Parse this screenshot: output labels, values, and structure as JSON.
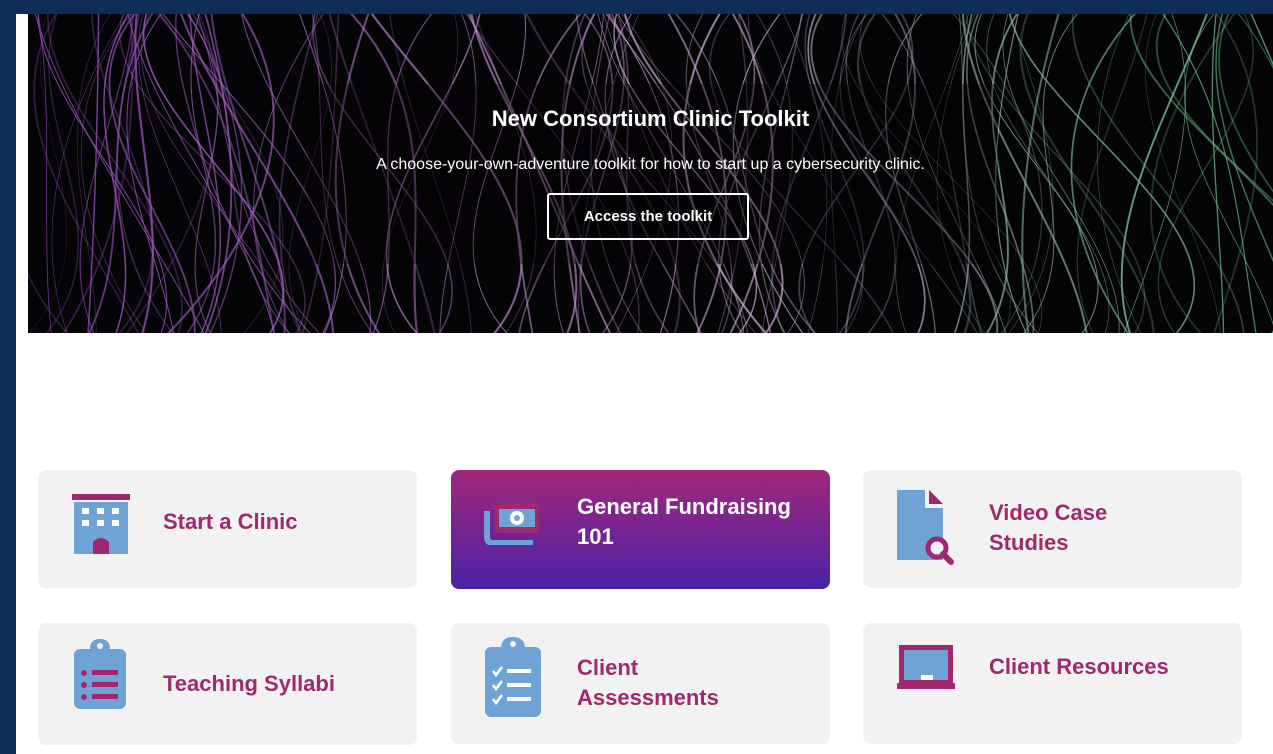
{
  "hero": {
    "title": "New Consortium Clinic Toolkit",
    "subtitle": "A choose-your-own-adventure toolkit for how to start up a cybersecurity clinic.",
    "button_label": "Access the toolkit"
  },
  "cards": [
    {
      "label": "Start a Clinic",
      "icon": "building-icon"
    },
    {
      "label": "General Fundraising 101",
      "icon": "money-icon"
    },
    {
      "label": "Video Case Studies",
      "icon": "file-search-icon"
    },
    {
      "label": "Teaching Syllabi",
      "icon": "clipboard-list-icon"
    },
    {
      "label": "Client Assessments",
      "icon": "clipboard-check-icon"
    },
    {
      "label": "Client Resources",
      "icon": "chalkboard-icon"
    }
  ],
  "colors": {
    "frame": "#0e2e57",
    "card_bg": "#f2f2f2",
    "card_text": "#a0286f",
    "icon_blue": "#6fa3d6",
    "icon_magenta": "#a0286f",
    "active_gradient_top": "#a1277a",
    "active_gradient_bottom": "#4b22a8"
  }
}
